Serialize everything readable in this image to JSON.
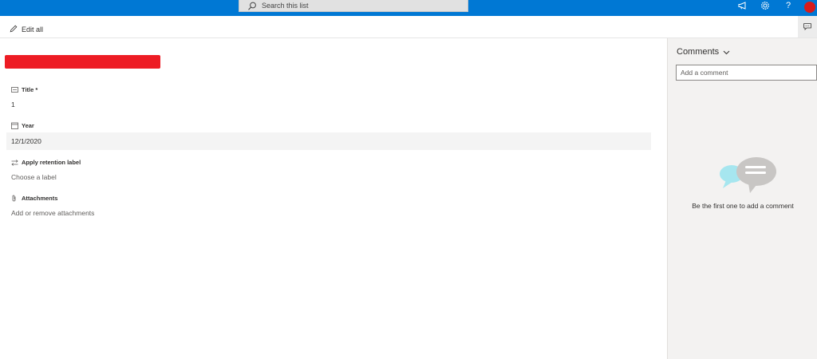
{
  "suitebar": {
    "search_placeholder": "Search this list",
    "icons": [
      "megaphone-icon",
      "gear-icon",
      "help-icon",
      "avatar"
    ],
    "help_glyph": "?",
    "colors": {
      "bar": "#0078d4",
      "avatar": "#d81b1b"
    }
  },
  "commandbar": {
    "edit_all_label": "Edit all",
    "edit_icon": "pencil-icon",
    "comments_toggle_icon": "comment-icon"
  },
  "form": {
    "redacted_color": "#ed1c24",
    "fields": [
      {
        "label": "Title *",
        "icon": "text-field-icon",
        "value": "1"
      },
      {
        "label": "Year",
        "icon": "calendar-icon",
        "value": "12/1/2020"
      },
      {
        "label": "Apply retention label",
        "icon": "transfer-icon",
        "value": "Choose a label"
      },
      {
        "label": "Attachments",
        "icon": "paperclip-icon",
        "value": "Add or remove attachments"
      }
    ]
  },
  "comments": {
    "title": "Comments",
    "input_placeholder": "Add a comment",
    "empty_message": "Be the first one to add a comment"
  }
}
